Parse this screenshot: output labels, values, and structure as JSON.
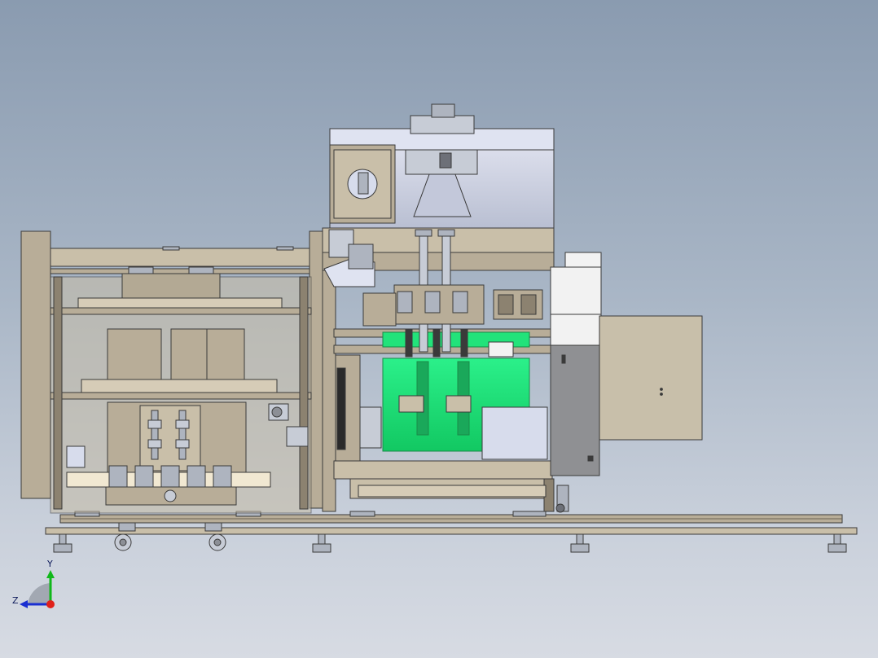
{
  "viewport": {
    "type": "3d-cad-model-view",
    "background_top": "#8a9bb0",
    "background_bottom": "#d7dbe3"
  },
  "model": {
    "colors": {
      "frame": "#b8ad98",
      "frame_dark": "#8c8270",
      "panel": "#c9bfa9",
      "panel_light": "#d6ccb7",
      "outline": "#3a3a3a",
      "steel": "#aeb4bf",
      "steel_light": "#c7ccd6",
      "glass_panel": "#d7dcec",
      "highlight_green": "#22e37a",
      "green_dark": "#1aa85a",
      "white_block": "#f2f2f2",
      "grey_cabinet": "#8f9093",
      "tan_cabinet": "#c8bfaa"
    }
  },
  "triad": {
    "icon": "coordinate-triad-icon",
    "axis_y_label": "Y",
    "axis_z_label": "Z",
    "y_color": "#10b81a",
    "z_color": "#1a2fd1",
    "x_color": "#e0201a"
  }
}
